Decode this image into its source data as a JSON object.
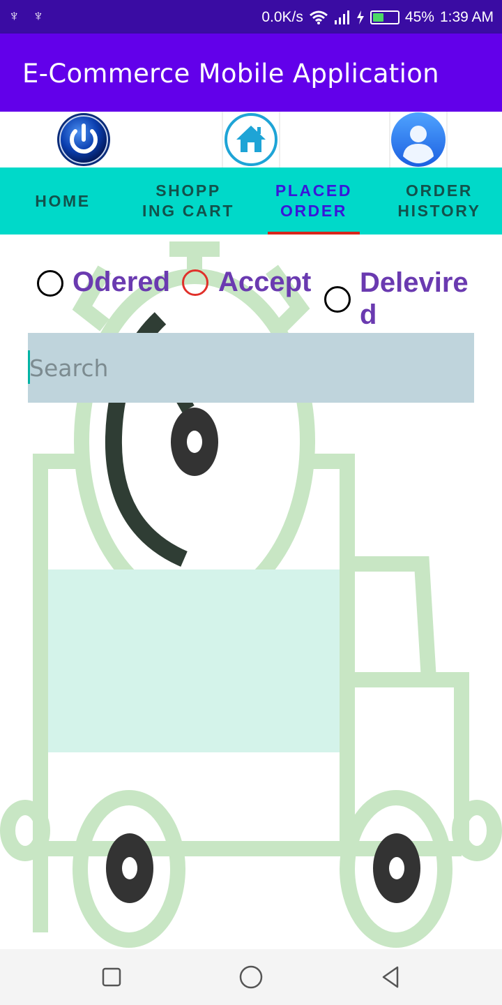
{
  "status_bar": {
    "left_icons": "♆ ♆",
    "net_speed": "0.0K/s",
    "battery_percent": "45%",
    "battery_level": 0.45,
    "time": "1:39 AM"
  },
  "app_bar": {
    "title": "E-Commerce Mobile Application"
  },
  "icon_row": {
    "icons": [
      "power-icon",
      "home-icon",
      "user-profile-icon"
    ]
  },
  "tabs": [
    {
      "label": "HOME"
    },
    {
      "label": "SHOPP\nING CART"
    },
    {
      "label": "PLACED\nORDER",
      "active": true
    },
    {
      "label": "ORDER\nHISTORY"
    }
  ],
  "order_status": {
    "options": [
      {
        "label": "Odered"
      },
      {
        "label": "Accept"
      },
      {
        "label": "Delevire\nd"
      }
    ]
  },
  "search": {
    "placeholder": "Search",
    "value": ""
  },
  "colors": {
    "status_bar": "#3a0ca3",
    "app_bar": "#6200ea",
    "tabs_bg": "#00d9c9",
    "tab_active": "#3a16d9",
    "indicator": "#d9261c",
    "radio_label": "#6a3ab0"
  }
}
